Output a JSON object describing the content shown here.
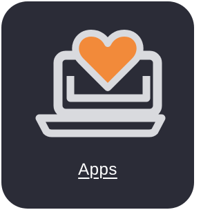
{
  "tile": {
    "label": "Apps",
    "icon": "laptop-heart-icon",
    "colors": {
      "background": "#2b2c37",
      "icon_outline": "#d9dade",
      "heart": "#f28a3a",
      "label": "#ffffff"
    }
  }
}
